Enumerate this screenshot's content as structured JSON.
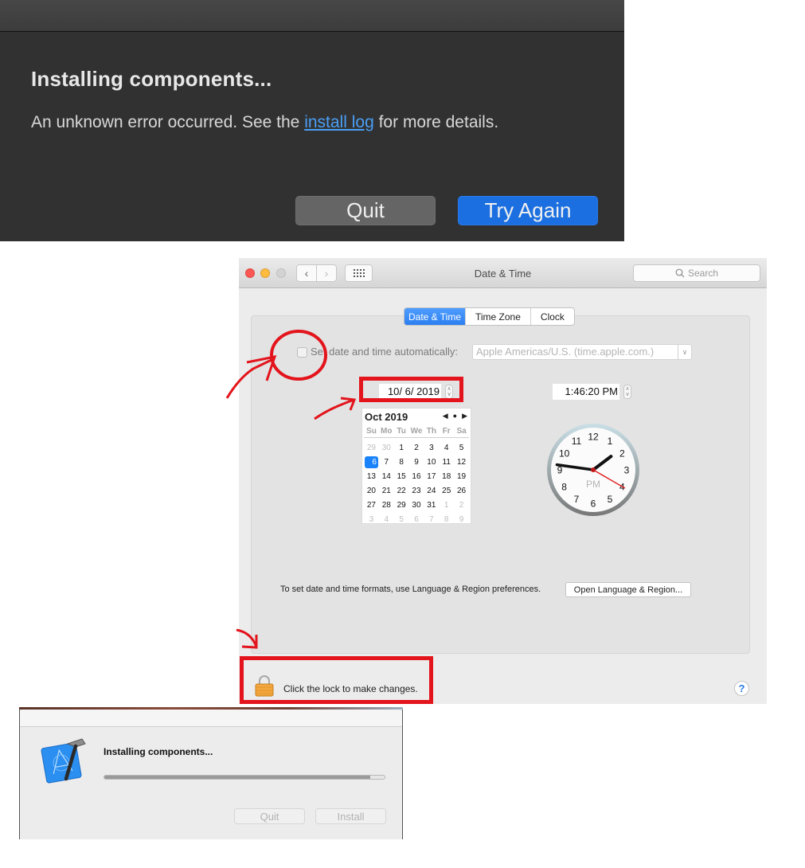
{
  "error_dialog": {
    "title": "Installing components...",
    "message_before": "An unknown error occurred. See the ",
    "link_text": "install log",
    "message_after": " for more details.",
    "quit_label": "Quit",
    "try_again_label": "Try Again",
    "accent_color": "#1b6fe0"
  },
  "datetime_window": {
    "title": "Date & Time",
    "search_placeholder": "Search",
    "tabs": [
      {
        "label": "Date & Time",
        "active": true
      },
      {
        "label": "Time Zone",
        "active": false
      },
      {
        "label": "Clock",
        "active": false
      }
    ],
    "auto_checkbox_label": "Set date and time automatically:",
    "auto_checked": false,
    "time_server": "Apple Americas/U.S. (time.apple.com.)",
    "date_value": "10/  6/ 2019",
    "time_value": "1:46:20 PM",
    "calendar": {
      "month_label": "Oct 2019",
      "weekdays": [
        "Su",
        "Mo",
        "Tu",
        "We",
        "Th",
        "Fr",
        "Sa"
      ],
      "days": [
        {
          "n": "29",
          "other": true
        },
        {
          "n": "30",
          "other": true
        },
        {
          "n": "1"
        },
        {
          "n": "2"
        },
        {
          "n": "3"
        },
        {
          "n": "4"
        },
        {
          "n": "5"
        },
        {
          "n": "6",
          "selected": true
        },
        {
          "n": "7"
        },
        {
          "n": "8"
        },
        {
          "n": "9"
        },
        {
          "n": "10"
        },
        {
          "n": "11"
        },
        {
          "n": "12"
        },
        {
          "n": "13"
        },
        {
          "n": "14"
        },
        {
          "n": "15"
        },
        {
          "n": "16"
        },
        {
          "n": "17"
        },
        {
          "n": "18"
        },
        {
          "n": "19"
        },
        {
          "n": "20"
        },
        {
          "n": "21"
        },
        {
          "n": "22"
        },
        {
          "n": "23"
        },
        {
          "n": "24"
        },
        {
          "n": "25"
        },
        {
          "n": "26"
        },
        {
          "n": "27"
        },
        {
          "n": "28"
        },
        {
          "n": "29"
        },
        {
          "n": "30"
        },
        {
          "n": "31"
        },
        {
          "n": "1",
          "other": true
        },
        {
          "n": "2",
          "other": true
        },
        {
          "n": "3",
          "other": true
        },
        {
          "n": "4",
          "other": true
        },
        {
          "n": "5",
          "other": true
        },
        {
          "n": "6",
          "other": true
        },
        {
          "n": "7",
          "other": true
        },
        {
          "n": "8",
          "other": true
        },
        {
          "n": "9",
          "other": true
        }
      ]
    },
    "clock": {
      "hour": 1,
      "minute": 46,
      "second": 20,
      "meridiem": "PM",
      "numerals": [
        "12",
        "1",
        "2",
        "3",
        "4",
        "5",
        "6",
        "7",
        "8",
        "9",
        "10",
        "11"
      ]
    },
    "formats_text": "To set date and time formats, use Language & Region preferences.",
    "open_lr_label": "Open Language & Region...",
    "lock_text": "Click the lock to make changes.",
    "help_label": "?"
  },
  "installer_dialog": {
    "title": "Installing components...",
    "progress": 0.95,
    "quit_label": "Quit",
    "install_label": "Install"
  },
  "annotation_color": "#e3141c"
}
